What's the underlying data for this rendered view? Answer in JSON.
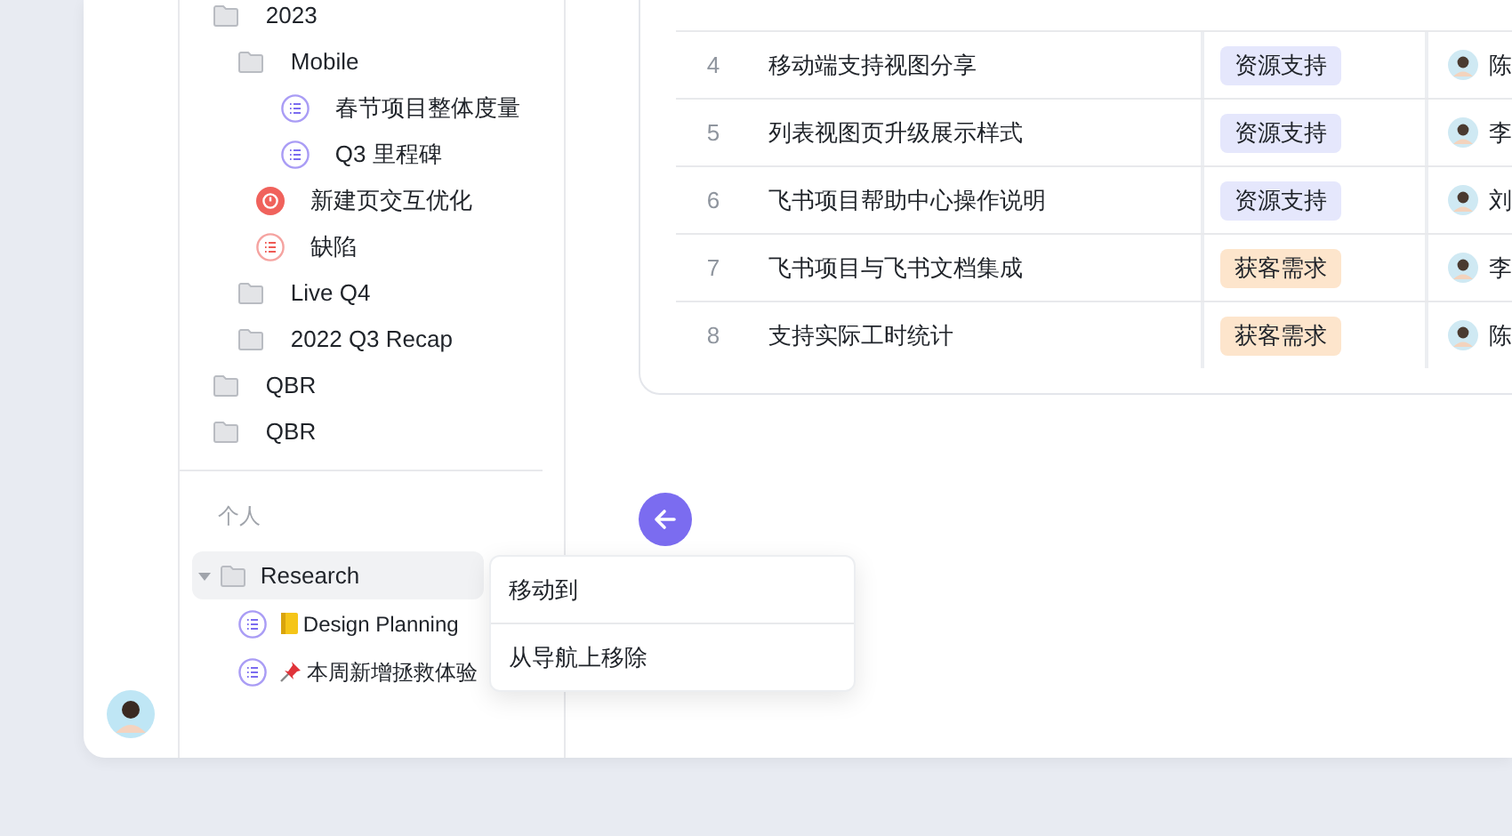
{
  "nav": {
    "tree": [
      {
        "kind": "folder",
        "label": "2023",
        "children": [
          {
            "kind": "folder",
            "label": "Mobile",
            "children": [
              {
                "kind": "doc",
                "label": "春节项目整体度量"
              },
              {
                "kind": "doc",
                "label": "Q3 里程碑"
              }
            ]
          },
          {
            "kind": "issue",
            "label": "新建页交互优化"
          },
          {
            "kind": "defect",
            "label": "缺陷"
          },
          {
            "kind": "folder",
            "label": "Live Q4"
          },
          {
            "kind": "folder",
            "label": "2022 Q3 Recap"
          }
        ]
      },
      {
        "kind": "folder",
        "label": "QBR"
      },
      {
        "kind": "folder",
        "label": "QBR"
      }
    ],
    "personal": {
      "heading": "个人",
      "items": [
        {
          "kind": "folder",
          "label": "Research",
          "expanded": true,
          "highlighted": true,
          "children": [
            {
              "kind": "notebook-doc",
              "label": "Design Planning"
            },
            {
              "kind": "pin-doc",
              "label": "本周新增拯救体验"
            }
          ]
        }
      ]
    }
  },
  "table": {
    "rows": [
      {
        "number": "4",
        "title": "移动端支持视图分享",
        "tag": {
          "text": "资源支持",
          "color": "#e5e7fc"
        },
        "person": "陈"
      },
      {
        "number": "5",
        "title": "列表视图页升级展示样式",
        "tag": {
          "text": "资源支持",
          "color": "#e5e7fc"
        },
        "person": "李"
      },
      {
        "number": "6",
        "title": "飞书项目帮助中心操作说明",
        "tag": {
          "text": "资源支持",
          "color": "#e5e7fc"
        },
        "person": "刘"
      },
      {
        "number": "7",
        "title": "飞书项目与飞书文档集成",
        "tag": {
          "text": "获客需求",
          "color": "#fde5cc"
        },
        "person": "李"
      },
      {
        "number": "8",
        "title": "支持实际工时统计",
        "tag": {
          "text": "获客需求",
          "color": "#fde5cc"
        },
        "person": "陈"
      }
    ]
  },
  "context_menu": {
    "items": [
      "移动到",
      "从导航上移除"
    ]
  }
}
